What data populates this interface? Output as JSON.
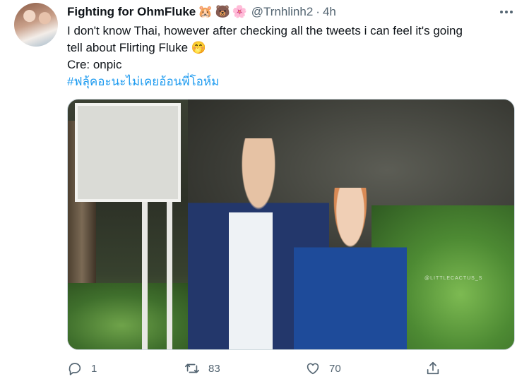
{
  "user": {
    "display_name": "Fighting for OhmFluke",
    "name_emojis": [
      "🐹",
      "🐻",
      "🌸"
    ],
    "handle": "@Trnhlinh2",
    "separator": "·",
    "time": "4h"
  },
  "tweet": {
    "line1": "I don't know Thai, however after checking all the tweets i can feel it's going",
    "line2": "tell about Flirting Fluke",
    "line2_emoji": "🤭",
    "credit": "Cre: onpic",
    "hashtag": "#ฟลุ้คอะนะไม่เคยอ้อนพี่โอห์ม"
  },
  "media": {
    "watermark": "@LITTLECACTUS_S"
  },
  "actions": {
    "reply_count": "1",
    "retweet_count": "83",
    "like_count": "70"
  },
  "colors": {
    "text": "#0f1419",
    "secondary": "#536471",
    "link": "#1d9bf0",
    "border": "#cfd9de"
  },
  "icons": [
    "more-icon",
    "reply-icon",
    "retweet-icon",
    "like-icon",
    "share-icon"
  ]
}
